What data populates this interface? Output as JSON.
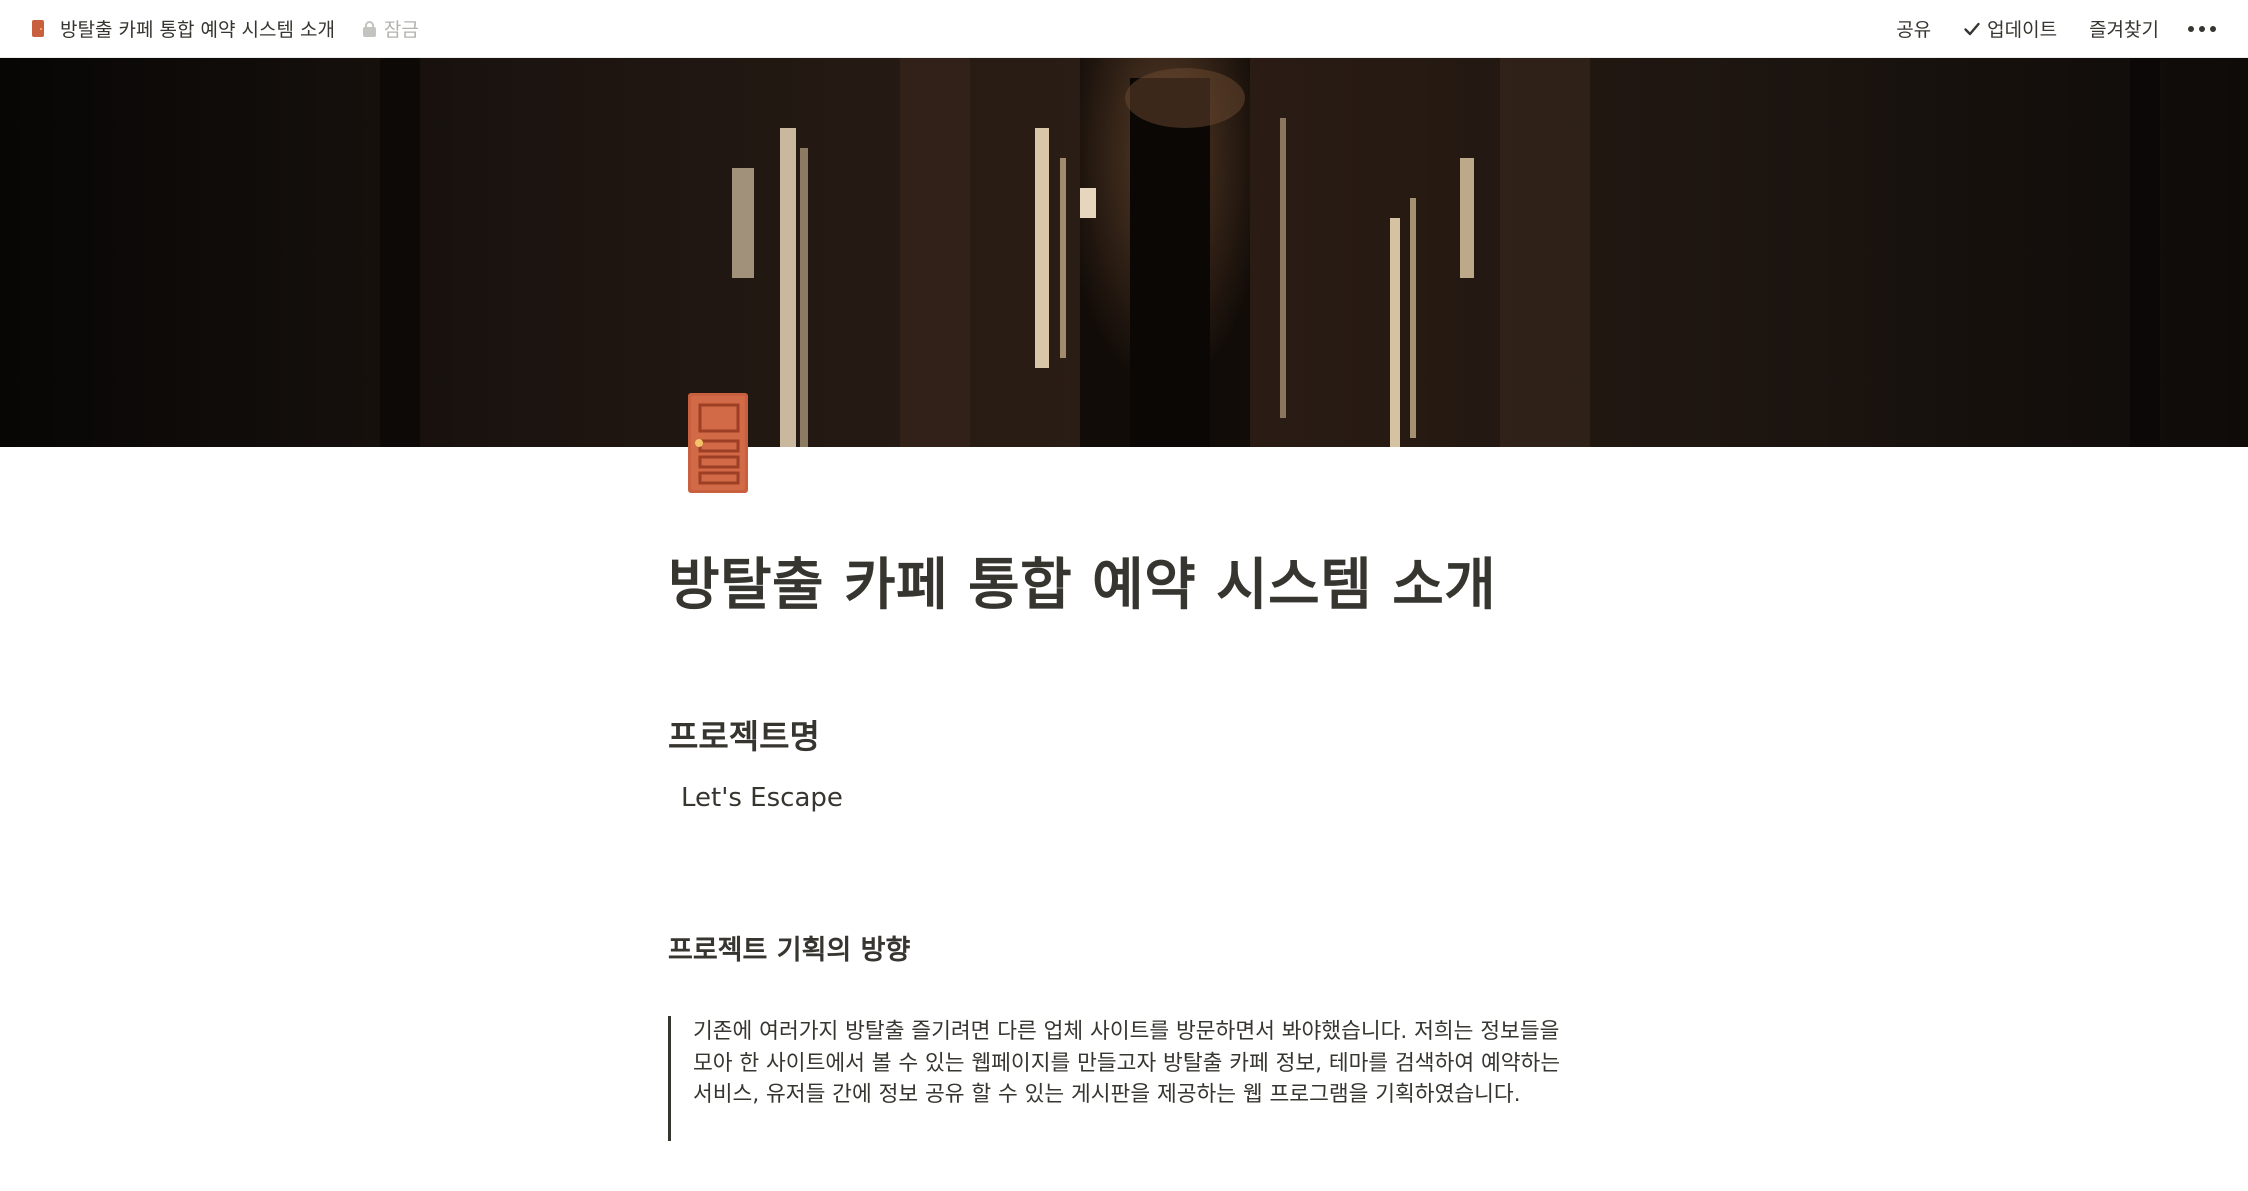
{
  "topbar": {
    "page_title": "방탈출 카페 통합 예약 시스템 소개",
    "lock_label": "잠금",
    "actions": {
      "share": "공유",
      "updates": "업데이트",
      "favorite": "즐겨찾기"
    }
  },
  "page": {
    "title": "방탈출 카페 통합 예약 시스템 소개",
    "icon": "door-icon",
    "cover": "dark-corridor-with-doors"
  },
  "sections": {
    "project_name_heading": "프로젝트명",
    "project_name_value": "Let's Escape",
    "direction_heading": "프로젝트 기획의 방향",
    "direction_quote": "기존에 여러가지 방탈출 즐기려면 다른 업체 사이트를 방문하면서 봐야했습니다. 저희는 정보들을 모아 한 사이트에서 볼 수 있는 웹페이지를 만들고자 방탈출 카페 정보, 테마를 검색하여 예약하는 서비스, 유저들 간에 정보 공유 할 수 있는 게시판을 제공하는 웹 프로그램을 기획하였습니다."
  },
  "colors": {
    "text": "#37352f",
    "muted": "#b3b2ae",
    "door": "#c8603f",
    "cover_dark": "#0d0907"
  }
}
